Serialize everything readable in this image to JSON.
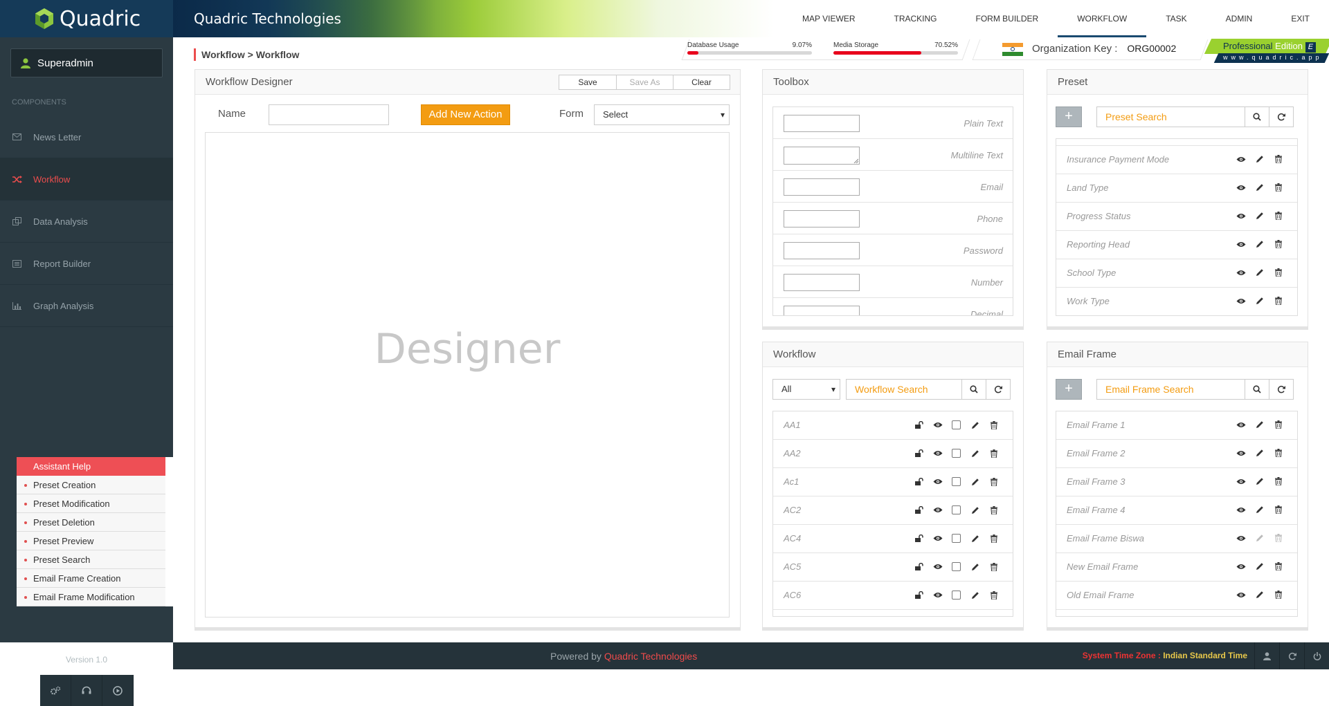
{
  "app": {
    "logo_text": "Quadric",
    "brand": "Quadric Technologies"
  },
  "nav": [
    {
      "label": "MAP VIEWER",
      "active": false
    },
    {
      "label": "TRACKING",
      "active": false
    },
    {
      "label": "FORM BUILDER",
      "active": false
    },
    {
      "label": "WORKFLOW",
      "active": true
    },
    {
      "label": "TASK",
      "active": false
    },
    {
      "label": "ADMIN",
      "active": false
    },
    {
      "label": "EXIT",
      "active": false
    }
  ],
  "usage": {
    "database": {
      "label": "Database Usage",
      "pct": "9.07%",
      "value": 0.0907
    },
    "media": {
      "label": "Media Storage",
      "pct": "70.52%",
      "value": 0.7052
    }
  },
  "org": {
    "label": "Organization Key :",
    "key": "ORG00002"
  },
  "edition": {
    "word1": "Professional",
    "word2": "Edition",
    "badge": "E",
    "site": "www.quadric.app"
  },
  "user": {
    "name": "Superadmin"
  },
  "sidebar": {
    "section": "COMPONENTS",
    "items": [
      {
        "label": "News Letter",
        "active": false
      },
      {
        "label": "Workflow",
        "active": true
      },
      {
        "label": "Data Analysis",
        "active": false
      },
      {
        "label": "Report Builder",
        "active": false
      },
      {
        "label": "Graph Analysis",
        "active": false
      }
    ],
    "version": "Version 1.0"
  },
  "help": {
    "title": "Assistant Help",
    "items": [
      "Preset Creation",
      "Preset Modification",
      "Preset Deletion",
      "Preset Preview",
      "Preset Search",
      "Email Frame Creation",
      "Email Frame Modification"
    ]
  },
  "breadcrumb": "Workflow > Workflow",
  "designer": {
    "title": "Workflow Designer",
    "save": "Save",
    "save_as": "Save As",
    "clear": "Clear",
    "name_label": "Name",
    "name_value": "",
    "add_action": "Add New Action",
    "form_label": "Form",
    "form_value": "Select",
    "placeholder": "Designer"
  },
  "toolbox": {
    "title": "Toolbox",
    "items": [
      "Plain Text",
      "Multiline Text",
      "Email",
      "Phone",
      "Password",
      "Number",
      "Decimal"
    ]
  },
  "preset": {
    "title": "Preset",
    "search_placeholder": "Preset Search",
    "items": [
      "Insurance Payment Mode",
      "Land Type",
      "Progress Status",
      "Reporting Head",
      "School Type",
      "Work Type"
    ]
  },
  "workflow": {
    "title": "Workflow",
    "filter": "All",
    "search_placeholder": "Workflow Search",
    "items": [
      "AA1",
      "AA2",
      "Ac1",
      "AC2",
      "AC4",
      "AC5",
      "AC6"
    ]
  },
  "email": {
    "title": "Email Frame",
    "search_placeholder": "Email Frame Search",
    "items": [
      "Email Frame 1",
      "Email Frame 2",
      "Email Frame 3",
      "Email Frame 4",
      "Email Frame Biswa",
      "New Email Frame",
      "Old Email Frame"
    ]
  },
  "footer": {
    "powered": "Powered by",
    "company": "Quadric Technologies",
    "tz_label": "System Time Zone :",
    "tz_value": "Indian Standard Time"
  }
}
